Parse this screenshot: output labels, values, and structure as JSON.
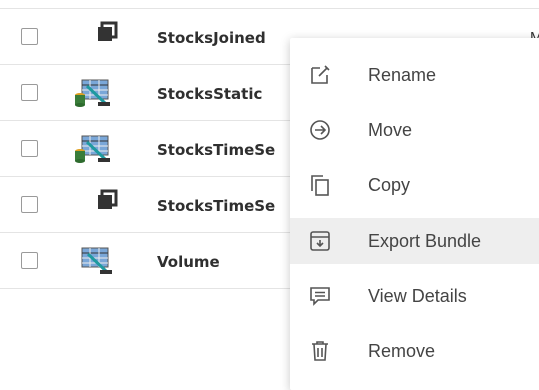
{
  "rows": [
    {
      "name": "StocksJoined",
      "icon": "joined-dataset-icon"
    },
    {
      "name": "StocksStatic",
      "icon": "database-table-icon"
    },
    {
      "name": "StocksTimeSe",
      "icon": "database-table-icon"
    },
    {
      "name": "StocksTimeSe",
      "icon": "joined-dataset-icon"
    },
    {
      "name": "Volume",
      "icon": "table-icon"
    }
  ],
  "partial_column_text": "M",
  "context_menu": {
    "items": [
      {
        "label": "Rename",
        "icon": "rename-icon"
      },
      {
        "label": "Move",
        "icon": "move-icon"
      },
      {
        "label": "Copy",
        "icon": "copy-icon"
      },
      {
        "label": "Export Bundle",
        "icon": "export-bundle-icon",
        "highlighted": true
      },
      {
        "label": "View Details",
        "icon": "view-details-icon"
      },
      {
        "label": "Remove",
        "icon": "trash-icon"
      }
    ]
  },
  "colors": {
    "menu_highlight": "#eeeeee",
    "divider": "#e4e4e4",
    "icon": "#555555"
  }
}
